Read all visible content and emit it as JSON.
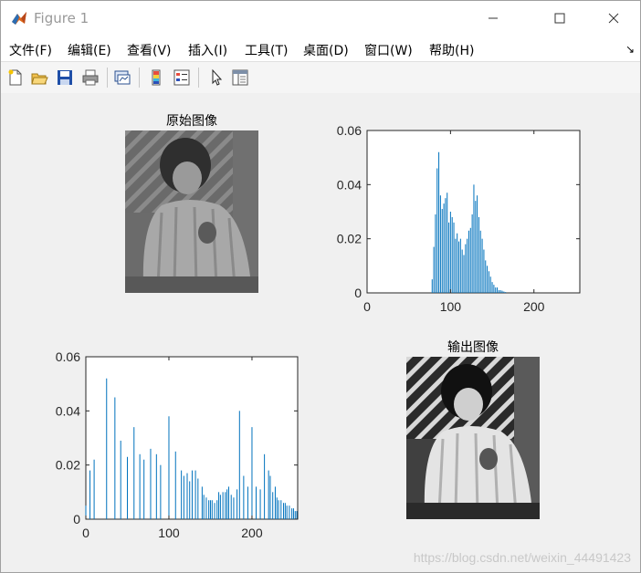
{
  "window": {
    "title": "Figure 1"
  },
  "menu": [
    {
      "label": "文件(F)"
    },
    {
      "label": "编辑(E)"
    },
    {
      "label": "查看(V)"
    },
    {
      "label": "插入(I)"
    },
    {
      "label": "工具(T)"
    },
    {
      "label": "桌面(D)"
    },
    {
      "label": "窗口(W)"
    },
    {
      "label": "帮助(H)"
    }
  ],
  "menu_arrow": "↘",
  "toolbar": {
    "icons": [
      "new-figure-icon",
      "open-file-icon",
      "save-icon",
      "print-icon",
      "link-plot-icon",
      "colorbar-icon",
      "legend-icon",
      "pointer-icon",
      "property-editor-icon"
    ]
  },
  "figure": {
    "input_title": "原始图像",
    "output_title": "输出图像"
  },
  "watermark": "https://blog.csdn.net/weixin_44491423",
  "colors": {
    "bar": "#0072bd",
    "axis": "#262626"
  },
  "chart_data": [
    {
      "type": "bar",
      "title": "",
      "xlabel": "",
      "ylabel": "",
      "xlim": [
        0,
        255
      ],
      "ylim": [
        0,
        0.06
      ],
      "xticks": [
        "0",
        "100",
        "200"
      ],
      "yticks": [
        "0",
        "0.02",
        "0.04",
        "0.06"
      ],
      "x": [
        78,
        80,
        82,
        84,
        86,
        88,
        90,
        92,
        94,
        96,
        98,
        100,
        102,
        104,
        106,
        108,
        110,
        112,
        114,
        116,
        118,
        120,
        122,
        124,
        126,
        128,
        130,
        132,
        134,
        136,
        138,
        140,
        142,
        144,
        146,
        148,
        150,
        152,
        154,
        156,
        158,
        160,
        162,
        164,
        166
      ],
      "values": [
        0.005,
        0.017,
        0.029,
        0.046,
        0.052,
        0.036,
        0.031,
        0.033,
        0.035,
        0.037,
        0.026,
        0.03,
        0.028,
        0.026,
        0.02,
        0.022,
        0.019,
        0.02,
        0.016,
        0.014,
        0.018,
        0.02,
        0.023,
        0.024,
        0.029,
        0.04,
        0.034,
        0.036,
        0.028,
        0.023,
        0.02,
        0.016,
        0.012,
        0.01,
        0.008,
        0.006,
        0.004,
        0.003,
        0.002,
        0.002,
        0.001,
        0.001,
        0.0008,
        0.0005,
        0.0003
      ]
    },
    {
      "type": "bar",
      "title": "",
      "xlabel": "",
      "ylabel": "",
      "xlim": [
        0,
        255
      ],
      "ylim": [
        0,
        0.06
      ],
      "xticks": [
        "0",
        "100",
        "200"
      ],
      "yticks": [
        "0",
        "0.02",
        "0.04",
        "0.06"
      ],
      "x": [
        0,
        5,
        10,
        25,
        35,
        42,
        50,
        58,
        65,
        70,
        78,
        85,
        90,
        100,
        108,
        115,
        118,
        122,
        125,
        128,
        132,
        135,
        140,
        142,
        145,
        148,
        150,
        152,
        155,
        158,
        160,
        162,
        165,
        168,
        170,
        172,
        175,
        178,
        182,
        185,
        190,
        195,
        200,
        205,
        210,
        215,
        220,
        222,
        225,
        228,
        230,
        232,
        235,
        238,
        240,
        242,
        245,
        248,
        250,
        252,
        254
      ],
      "values": [
        0.005,
        0.018,
        0.022,
        0.052,
        0.045,
        0.029,
        0.023,
        0.034,
        0.024,
        0.022,
        0.026,
        0.024,
        0.02,
        0.038,
        0.025,
        0.018,
        0.016,
        0.017,
        0.014,
        0.018,
        0.018,
        0.015,
        0.012,
        0.009,
        0.008,
        0.007,
        0.007,
        0.007,
        0.006,
        0.007,
        0.01,
        0.009,
        0.01,
        0.01,
        0.011,
        0.012,
        0.009,
        0.008,
        0.011,
        0.04,
        0.016,
        0.012,
        0.034,
        0.012,
        0.011,
        0.024,
        0.018,
        0.016,
        0.01,
        0.012,
        0.008,
        0.007,
        0.007,
        0.006,
        0.006,
        0.005,
        0.005,
        0.004,
        0.004,
        0.003,
        0.003
      ]
    }
  ]
}
